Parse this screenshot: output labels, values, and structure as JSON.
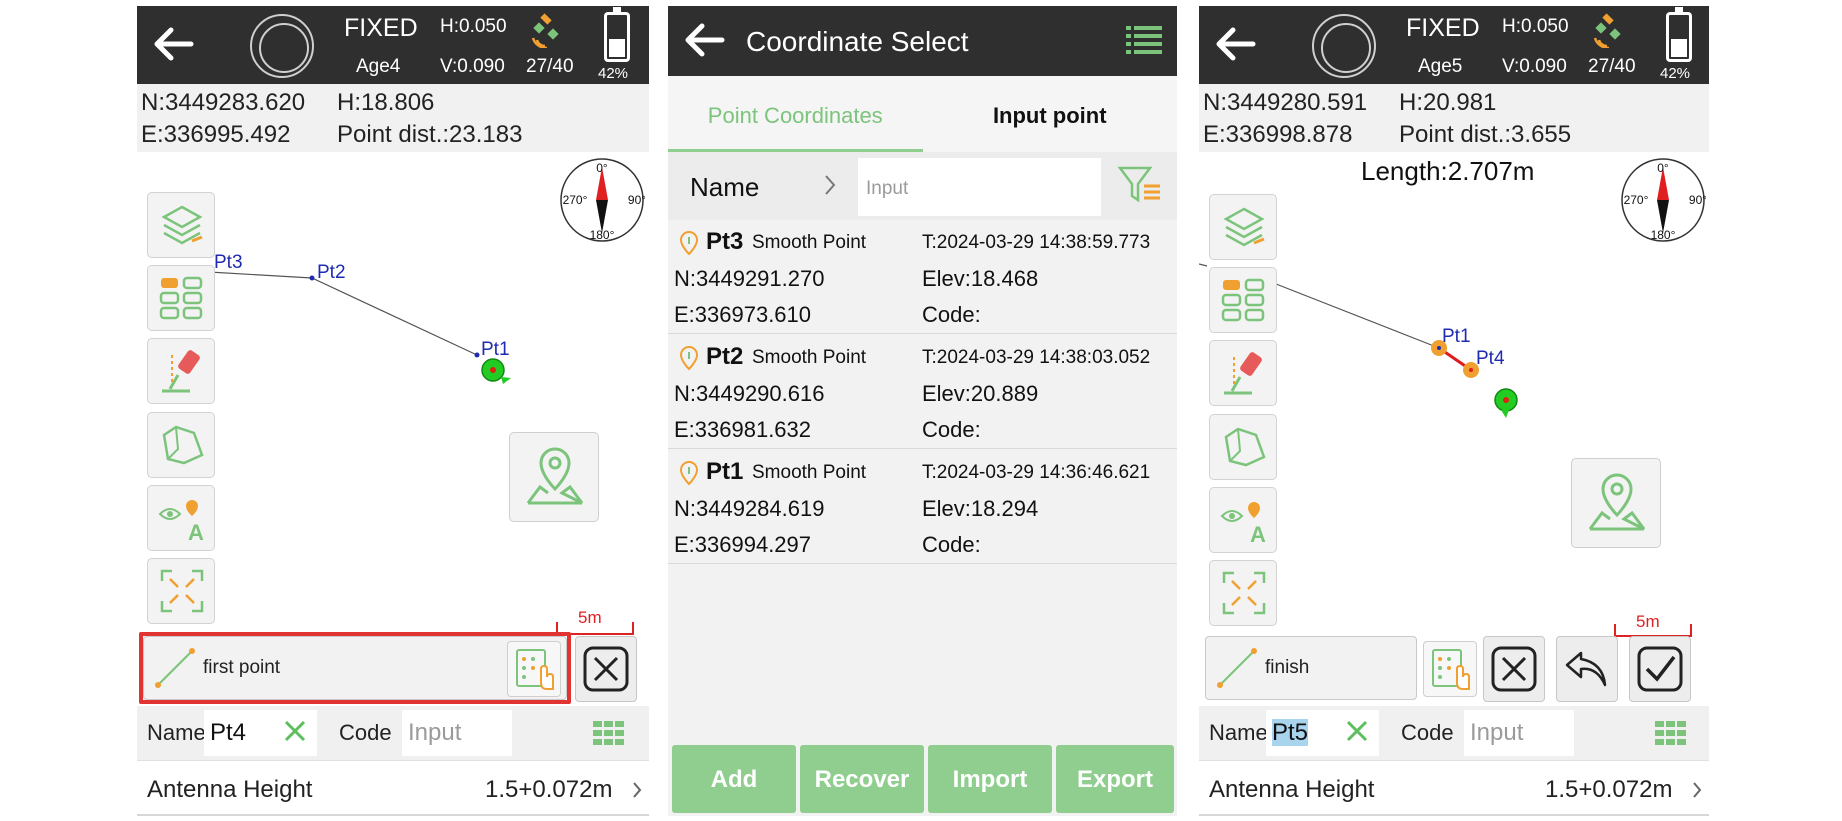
{
  "left": {
    "status": {
      "fix": "FIXED",
      "age": "Age4",
      "h_prec": "H:0.050",
      "v_prec": "V:0.090",
      "sats": "27/40",
      "battery": "42%",
      "battery_level": 0.42
    },
    "coords": {
      "n": "N:3449283.620",
      "e": "E:336995.492",
      "h": "H:18.806",
      "dist": "Point dist.:23.183"
    },
    "map": {
      "points": [
        "Pt3",
        "Pt2",
        "Pt1"
      ],
      "compass": {
        "north": "0°",
        "east": "90°",
        "south": "180°",
        "west": "270°"
      },
      "scale": "5m"
    },
    "tool": {
      "label": "first point"
    },
    "form": {
      "name_label": "Name",
      "name_value": "Pt4",
      "code_label": "Code",
      "code_placeholder": "Input"
    },
    "antenna": {
      "label": "Antenna Height",
      "value": "1.5+0.072m"
    }
  },
  "middle": {
    "title": "Coordinate Select",
    "tabs": [
      "Point Coordinates",
      "Input point"
    ],
    "filter": {
      "label": "Name",
      "placeholder": "Input"
    },
    "records": [
      {
        "name": "Pt3",
        "type": "Smooth Point",
        "time": "T:2024-03-29 14:38:59.773",
        "n": "N:3449291.270",
        "e": "E:336973.610",
        "elev": "Elev:18.468",
        "code": "Code:"
      },
      {
        "name": "Pt2",
        "type": "Smooth Point",
        "time": "T:2024-03-29 14:38:03.052",
        "n": "N:3449290.616",
        "e": "E:336981.632",
        "elev": "Elev:20.889",
        "code": "Code:"
      },
      {
        "name": "Pt1",
        "type": "Smooth Point",
        "time": "T:2024-03-29 14:36:46.621",
        "n": "N:3449284.619",
        "e": "E:336994.297",
        "elev": "Elev:18.294",
        "code": "Code:"
      }
    ],
    "actions": [
      "Add",
      "Recover",
      "Import",
      "Export"
    ]
  },
  "right": {
    "status": {
      "fix": "FIXED",
      "age": "Age5",
      "h_prec": "H:0.050",
      "v_prec": "V:0.090",
      "sats": "27/40",
      "battery": "42%",
      "battery_level": 0.42
    },
    "coords": {
      "n": "N:3449280.591",
      "e": "E:336998.878",
      "h": "H:20.981",
      "dist": "Point dist.:3.655"
    },
    "map": {
      "length": "Length:2.707m",
      "points": [
        "Pt1",
        "Pt4"
      ],
      "compass": {
        "north": "0°",
        "east": "90°",
        "south": "180°",
        "west": "270°"
      },
      "scale": "5m"
    },
    "tool": {
      "label": "finish"
    },
    "form": {
      "name_label": "Name",
      "name_value": "Pt5",
      "code_label": "Code",
      "code_placeholder": "Input"
    },
    "antenna": {
      "label": "Antenna Height",
      "value": "1.5+0.072m"
    }
  },
  "colors": {
    "header": "#2f2f2f",
    "accent_green": "#8fce8f",
    "highlight_red": "#e23333",
    "point_label": "#1f2bb0",
    "orange": "#f0a030"
  }
}
